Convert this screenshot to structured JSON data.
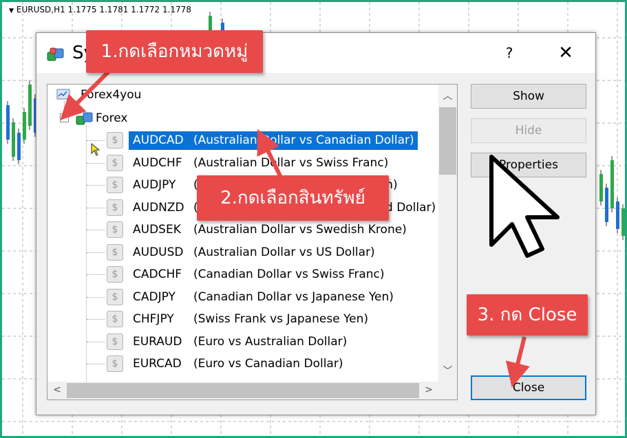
{
  "chart_window": {
    "title": "EURUSD,H1  1.1775 1.1781 1.1772 1.1778"
  },
  "dialog": {
    "title": "Sy",
    "help_label": "?",
    "close_icon": "close-icon",
    "tree": {
      "server": {
        "label": "Forex4you",
        "icon": "server-icon"
      },
      "group": {
        "label": "Forex",
        "expanded": true,
        "toggle": "⊟",
        "icon": "folder-icon"
      },
      "symbol_icon_glyph": "$",
      "items": [
        {
          "symbol": "AUDCAD",
          "description": "(Australian Dollar vs Canadian Dollar)",
          "selected": true
        },
        {
          "symbol": "AUDCHF",
          "description": "(Australian Dollar vs Swiss Franc)"
        },
        {
          "symbol": "AUDJPY",
          "description": "(Australian Dollar vs Japanese Yen)"
        },
        {
          "symbol": "AUDNZD",
          "description": "(Australian Dollar vs New Zealand Dollar)"
        },
        {
          "symbol": "AUDSEK",
          "description": "(Australian Dollar vs Swedish Krone)"
        },
        {
          "symbol": "AUDUSD",
          "description": "(Australian Dollar vs US Dollar)"
        },
        {
          "symbol": "CADCHF",
          "description": "(Canadian Dollar vs Swiss Franc)"
        },
        {
          "symbol": "CADJPY",
          "description": "(Canadian Dollar vs Japanese Yen)"
        },
        {
          "symbol": "CHFJPY",
          "description": "(Swiss Frank vs Japanese Yen)"
        },
        {
          "symbol": "EURAUD",
          "description": "(Euro vs Australian Dollar)"
        },
        {
          "symbol": "EURCAD",
          "description": "(Euro vs Canadian Dollar)"
        }
      ]
    },
    "buttons": {
      "show": "Show",
      "hide": "Hide",
      "properties": "Properties",
      "close": "Close"
    },
    "scroll_arrows": {
      "up": "⌃",
      "down": "⌄",
      "left": "<",
      "right": ">"
    }
  },
  "annotations": {
    "step1": "1.กดเลือกหมวดหมู่",
    "step2": "2.กดเลือกสินทรัพย์",
    "step3": "3. กด Close"
  },
  "colors": {
    "frame_border": "#1ea97c",
    "callout_red": "#e84a4a",
    "selection_blue": "#0b72d4",
    "bull_candle": "#2ea84a",
    "bear_candle": "#1f6fd1"
  }
}
